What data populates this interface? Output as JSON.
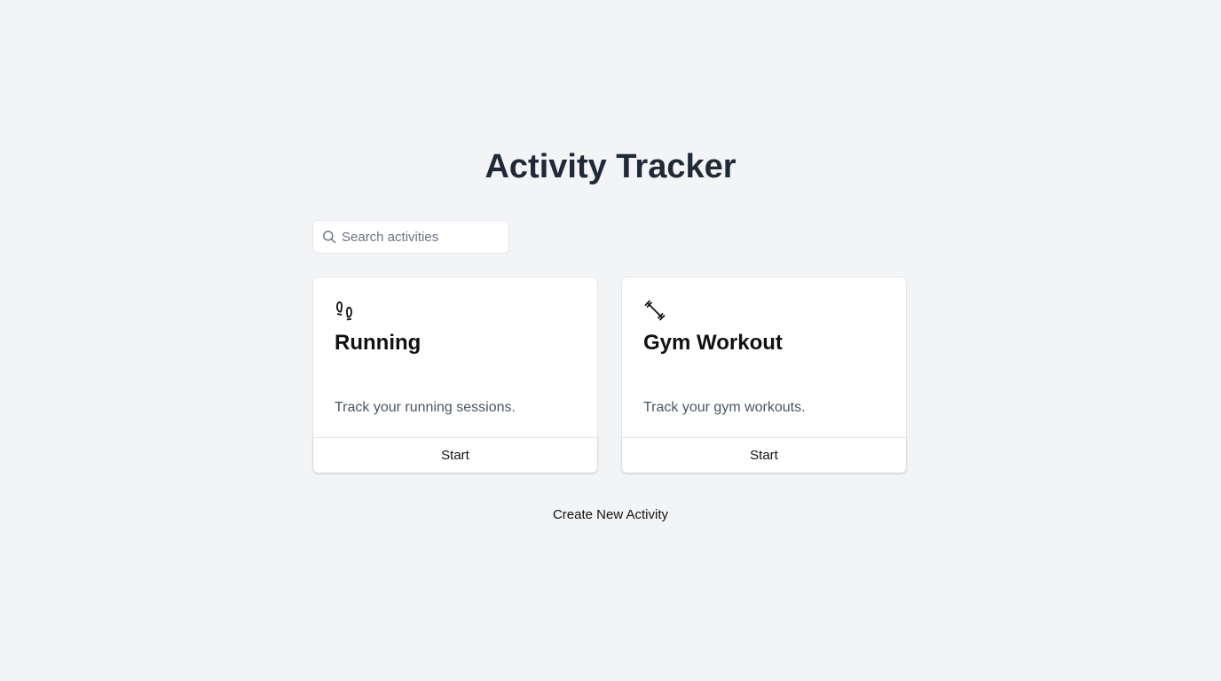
{
  "header": {
    "title": "Activity Tracker"
  },
  "search": {
    "placeholder": "Search activities",
    "value": "",
    "icon": "search-icon"
  },
  "activities": [
    {
      "icon": "footprints-icon",
      "title": "Running",
      "description": "Track your running sessions.",
      "button_label": "Start"
    },
    {
      "icon": "dumbbell-icon",
      "title": "Gym Workout",
      "description": "Track your gym workouts.",
      "button_label": "Start"
    }
  ],
  "footer": {
    "create_label": "Create New Activity"
  },
  "colors": {
    "background": "#f3f4f6",
    "title": "#1f2937",
    "muted_text": "#4b5563",
    "border": "#e5e7eb"
  }
}
